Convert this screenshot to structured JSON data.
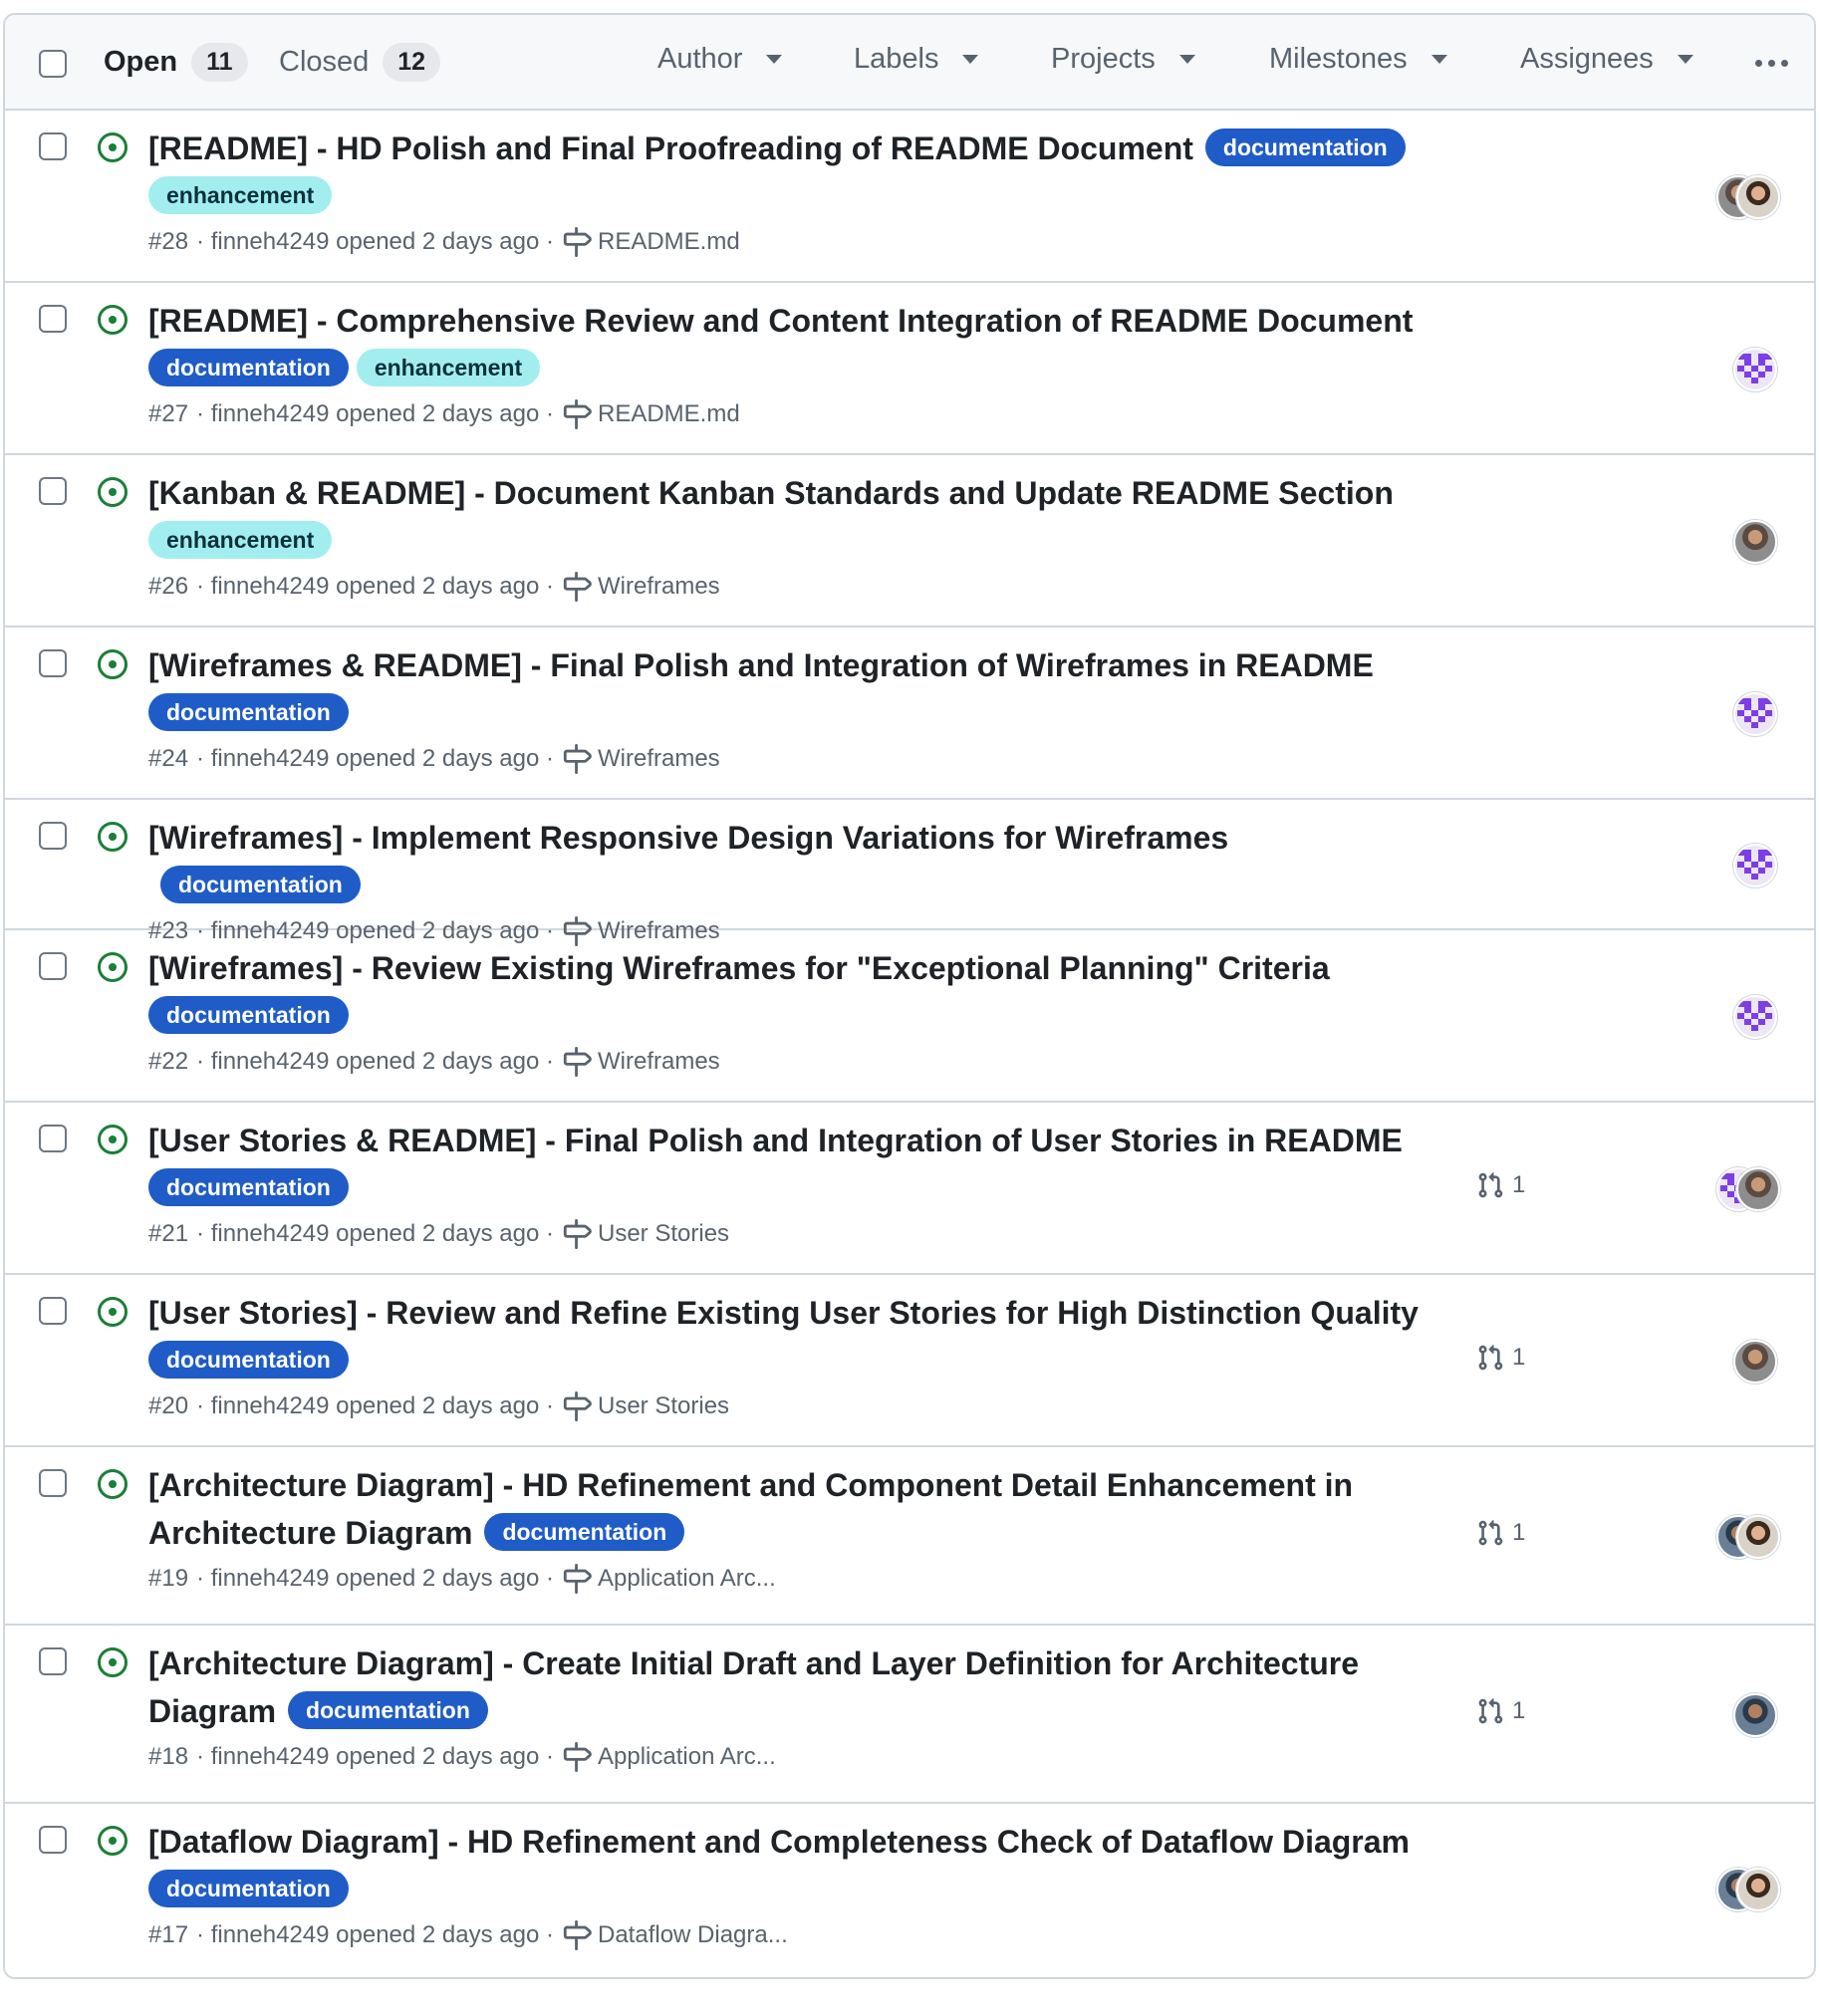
{
  "header": {
    "open_label": "Open",
    "open_count": "11",
    "closed_label": "Closed",
    "closed_count": "12",
    "filters": [
      "Author",
      "Labels",
      "Projects",
      "Milestones",
      "Assignees"
    ]
  },
  "colors": {
    "documentation": "#1f5cc7",
    "enhancement": "#a2eeef",
    "open_icon": "#1a7f37",
    "identicon": "#7b3fe4"
  },
  "issues": [
    {
      "title_lines": [
        "[README] - HD Polish and Final Proofreading of README Document"
      ],
      "labels": [
        "documentation",
        "enhancement"
      ],
      "number": "#28",
      "meta": "· finneh4249 opened 2 days ago ·",
      "milestone": "README.md",
      "pr_count": "",
      "avatars": [
        "photo-1",
        "photo-2"
      ]
    },
    {
      "title_lines": [
        "[README] - Comprehensive Review and Content Integration of README Document"
      ],
      "labels": [
        "documentation",
        "enhancement"
      ],
      "number": "#27",
      "meta": "· finneh4249 opened 2 days ago ·",
      "milestone": "README.md",
      "pr_count": "",
      "avatars": [
        "identicon"
      ]
    },
    {
      "title_lines": [
        "[Kanban & README] - Document Kanban Standards and Update README Section"
      ],
      "labels": [
        "enhancement"
      ],
      "number": "#26",
      "meta": "· finneh4249 opened 2 days ago ·",
      "milestone": "Wireframes",
      "pr_count": "",
      "avatars": [
        "photo-1"
      ]
    },
    {
      "title_lines": [
        "[Wireframes & README] - Final Polish and Integration of Wireframes in README"
      ],
      "labels": [
        "documentation"
      ],
      "number": "#24",
      "meta": "· finneh4249 opened 2 days ago ·",
      "milestone": "Wireframes",
      "pr_count": "",
      "avatars": [
        "identicon"
      ]
    },
    {
      "title_lines": [
        "[Wireframes] - Implement Responsive Design Variations for Wireframes"
      ],
      "labels": [
        "documentation"
      ],
      "number": "#23",
      "meta": "· finneh4249 opened 2 days ago ·",
      "milestone": "Wireframes",
      "pr_count": "",
      "avatars": [
        "identicon"
      ]
    },
    {
      "title_lines": [
        "[Wireframes] - Review Existing Wireframes for \"Exceptional Planning\" Criteria"
      ],
      "labels": [
        "documentation"
      ],
      "number": "#22",
      "meta": "· finneh4249 opened 2 days ago ·",
      "milestone": "Wireframes",
      "pr_count": "",
      "avatars": [
        "identicon"
      ]
    },
    {
      "title_lines": [
        "[User Stories & README] - Final Polish and Integration of User Stories in README"
      ],
      "labels": [
        "documentation"
      ],
      "number": "#21",
      "meta": "· finneh4249 opened 2 days ago ·",
      "milestone": "User Stories",
      "pr_count": "1",
      "avatars": [
        "identicon",
        "photo-1"
      ]
    },
    {
      "title_lines": [
        "[User Stories] - Review and Refine Existing User Stories for High Distinction Quality"
      ],
      "labels": [
        "documentation"
      ],
      "number": "#20",
      "meta": "· finneh4249 opened 2 days ago ·",
      "milestone": "User Stories",
      "pr_count": "1",
      "avatars": [
        "photo-1"
      ]
    },
    {
      "title_lines": [
        "[Architecture Diagram] - HD Refinement and Component Detail Enhancement in",
        "Architecture Diagram"
      ],
      "labels": [
        "documentation"
      ],
      "number": "#19",
      "meta": "· finneh4249 opened 2 days ago ·",
      "milestone": "Application Arc...",
      "pr_count": "1",
      "avatars": [
        "photo-3",
        "photo-2"
      ]
    },
    {
      "title_lines": [
        "[Architecture Diagram] - Create Initial Draft and Layer Definition for Architecture",
        "Diagram"
      ],
      "labels": [
        "documentation"
      ],
      "number": "#18",
      "meta": "· finneh4249 opened 2 days ago ·",
      "milestone": "Application Arc...",
      "pr_count": "1",
      "avatars": [
        "photo-3"
      ]
    },
    {
      "title_lines": [
        "[Dataflow Diagram] - HD Refinement and Completeness Check of Dataflow Diagram"
      ],
      "labels": [
        "documentation"
      ],
      "number": "#17",
      "meta": "· finneh4249 opened 2 days ago ·",
      "milestone": "Dataflow Diagra...",
      "pr_count": "",
      "avatars": [
        "photo-3",
        "photo-2"
      ]
    }
  ]
}
